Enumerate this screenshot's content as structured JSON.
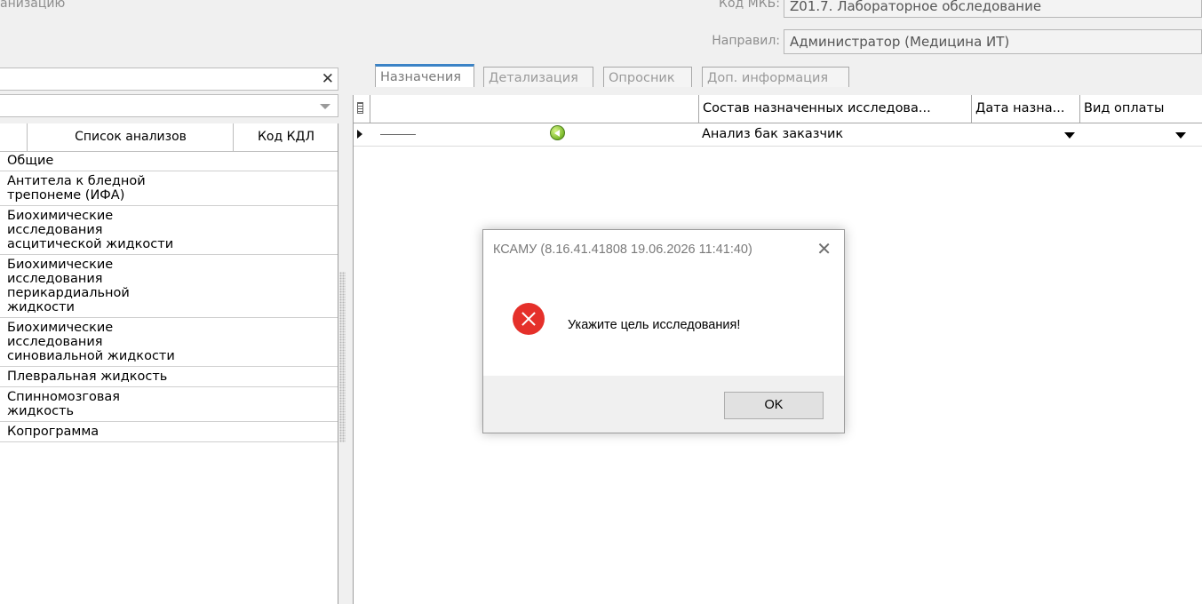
{
  "header": {
    "cut_text": "анизацию",
    "mkb_label": "Код МКБ:",
    "mkb_value": "Z01.7. Лабораторное обследование",
    "directed_label": "Направил:",
    "directed_value": "Администратор (Медицина ИТ)"
  },
  "left_panel": {
    "close_glyph": "✕",
    "columns": [
      "Список анализов",
      "Код КДЛ"
    ],
    "items": [
      "Общие",
      "Антитела к бледной\nтрепонеме (ИФА)",
      "Биохимические\nисследования\nасцитической жидкости",
      "Биохимические\nисследования\nперикардиальной\nжидкости",
      "Биохимические\nисследования\nсиновиальной жидкости",
      "Плевральная жидкость",
      "Спинномозговая\nжидкость",
      "Копрограмма"
    ]
  },
  "tabs": [
    "Назначения",
    "Детализация",
    "Опросник",
    "Доп. информация"
  ],
  "grid": {
    "columns": [
      "Состав назначенных исследова...",
      "Дата назна...",
      "Вид оплаты"
    ],
    "row": {
      "composition": "Анализ бак заказчик"
    }
  },
  "dialog": {
    "title": "КСАМУ (8.16.41.41808 19.06.2026 11:41:40)",
    "close_glyph": "✕",
    "message": "Укажите цель исследования!",
    "ok_label": "OK"
  }
}
